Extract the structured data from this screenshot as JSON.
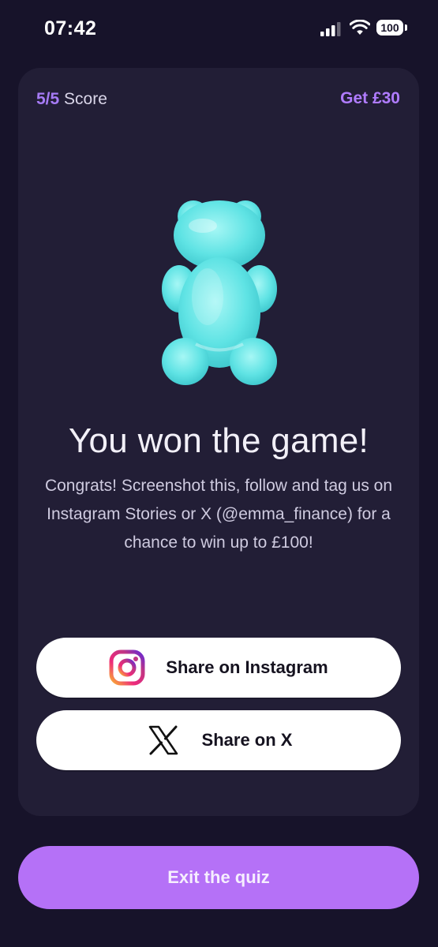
{
  "status_bar": {
    "time": "07:42",
    "battery_level": "100",
    "icons": [
      "cellular-signal-icon",
      "wifi-icon",
      "battery-icon"
    ]
  },
  "card": {
    "score_fraction": "5/5",
    "score_label": "Score",
    "reward_link": "Get £30",
    "illustration": "gummy-bear",
    "headline": "You won the game!",
    "message": "Congrats! Screenshot this, follow and tag us on Instagram Stories or X (@emma_finance) for a chance to win up to £100!",
    "buttons": [
      {
        "label": "Share on Instagram",
        "icon": "instagram-icon"
      },
      {
        "label": "Share on X",
        "icon": "x-logo-icon"
      }
    ]
  },
  "exit_button": {
    "label": "Exit the quiz"
  },
  "colors": {
    "background": "#17132a",
    "card": "#221e36",
    "accent_purple": "#b571f7",
    "gummy_bear": "#5ee6e6"
  }
}
